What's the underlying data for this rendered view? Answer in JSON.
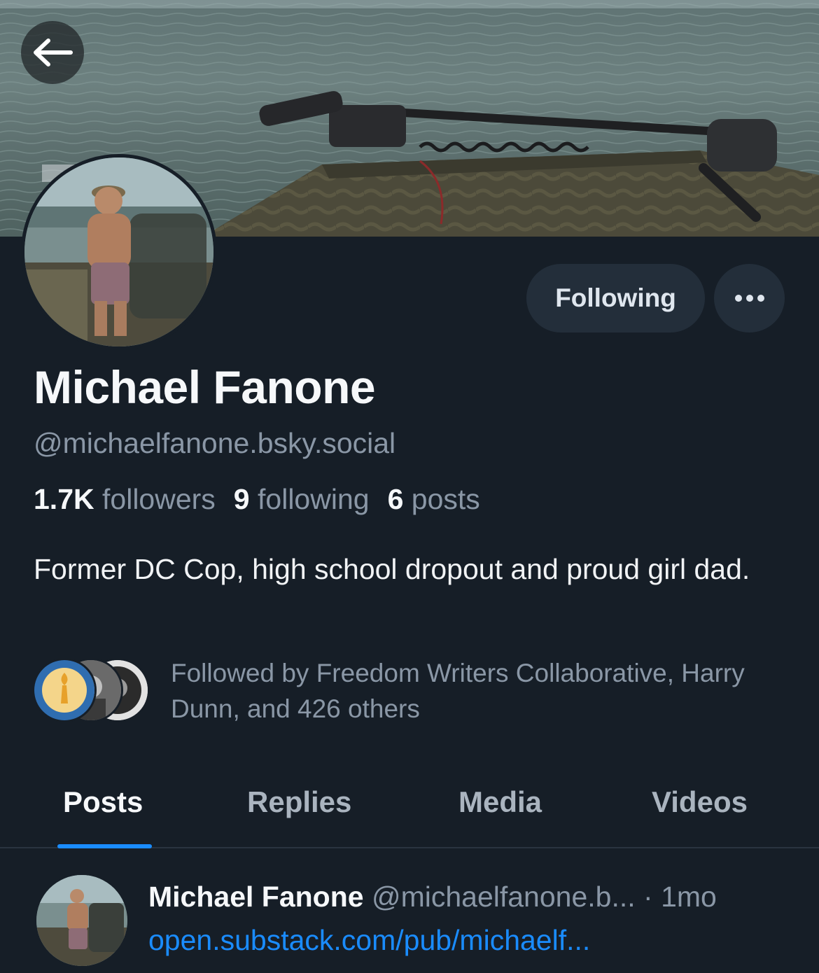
{
  "header": {
    "back_icon": "arrow-left-icon"
  },
  "profile": {
    "display_name": "Michael Fanone",
    "handle": "@michaelfanone.bsky.social",
    "following_button_label": "Following",
    "more_icon": "ellipsis-icon",
    "stats": {
      "followers_count": "1.7K",
      "followers_label": "followers",
      "following_count": "9",
      "following_label": "following",
      "posts_count": "6",
      "posts_label": "posts"
    },
    "bio": "Former DC Cop, high school dropout and proud girl dad.",
    "followed_by": "Followed by Freedom Writers Collaborative, Harry Dunn, and 426 others"
  },
  "tabs": [
    {
      "label": "Posts",
      "active": true
    },
    {
      "label": "Replies",
      "active": false
    },
    {
      "label": "Media",
      "active": false
    },
    {
      "label": "Videos",
      "active": false
    }
  ],
  "feed": {
    "posts": [
      {
        "author_name": "Michael Fanone",
        "author_handle": "@michaelfanone.b...",
        "separator": " · ",
        "time": "1mo",
        "link_text": "open.substack.com/pub/michaelf..."
      }
    ]
  },
  "colors": {
    "background": "#161e27",
    "button_bg": "#232e3a",
    "accent": "#1a8cff",
    "muted_text": "#8a97a6"
  }
}
